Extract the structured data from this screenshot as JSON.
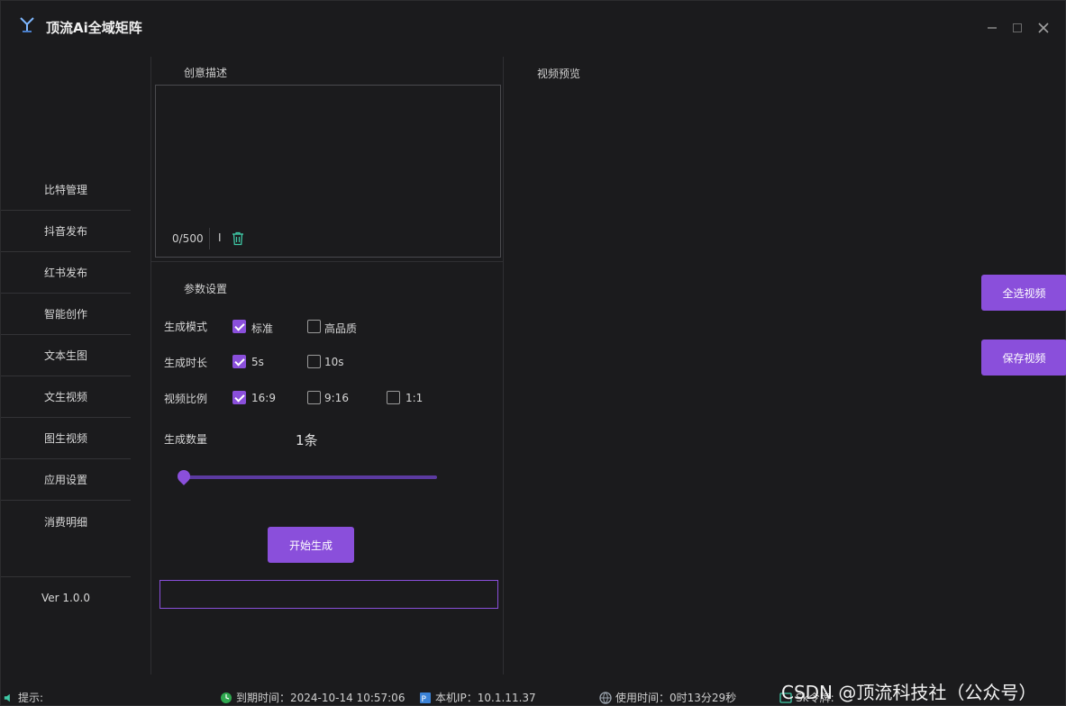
{
  "window": {
    "title": "顶流Ai全域矩阵",
    "controls": {
      "minimize": "—",
      "maximize": "□",
      "close": "✕"
    }
  },
  "sidebar": {
    "items": [
      {
        "label": "比特管理"
      },
      {
        "label": "抖音发布"
      },
      {
        "label": "红书发布"
      },
      {
        "label": "智能创作"
      },
      {
        "label": "文本生图"
      },
      {
        "label": "文生视频"
      },
      {
        "label": "图生视频"
      },
      {
        "label": "应用设置"
      },
      {
        "label": "消费明细"
      }
    ],
    "version": "Ver 1.0.0"
  },
  "creative": {
    "label": "创意描述",
    "value": "",
    "counter": "0/500",
    "cursor_mark": "I"
  },
  "params": {
    "label": "参数设置",
    "mode": {
      "label": "生成模式",
      "options": [
        {
          "label": "标准",
          "checked": true
        },
        {
          "label": "高品质",
          "checked": false
        }
      ]
    },
    "duration": {
      "label": "生成时长",
      "options": [
        {
          "label": "5s",
          "checked": true
        },
        {
          "label": "10s",
          "checked": false
        }
      ]
    },
    "ratio": {
      "label": "视频比例",
      "options": [
        {
          "label": "16:9",
          "checked": true
        },
        {
          "label": "9:16",
          "checked": false
        },
        {
          "label": "1:1",
          "checked": false
        }
      ]
    },
    "count": {
      "label": "生成数量",
      "value": "1条",
      "slider_fraction": 0
    },
    "start_button": "开始生成",
    "output_value": ""
  },
  "preview": {
    "label": "视频预览",
    "select_all_button": "全选视频",
    "save_button": "保存视频"
  },
  "statusbar": {
    "hint": "提示:",
    "expire": "到期时间：2024-10-14 10:57:06",
    "ip": "本机IP：10.1.11.37",
    "usage": "使用时间：0时13分29秒",
    "sk": "Sk令牌:"
  },
  "watermark": "CSDN @顶流科技社（公众号）",
  "colors": {
    "accent": "#8a4fdb",
    "background": "#1b1b1d",
    "text": "#d6d6d6"
  }
}
